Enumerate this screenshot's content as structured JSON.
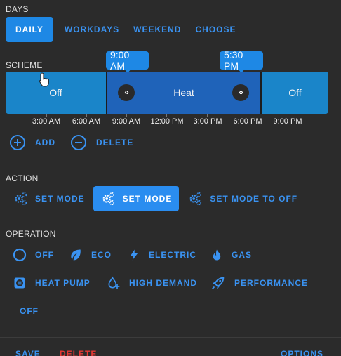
{
  "days": {
    "label": "DAYS",
    "options": [
      "DAILY",
      "WORKDAYS",
      "WEEKEND",
      "CHOOSE"
    ],
    "selected": "DAILY"
  },
  "scheme": {
    "label": "SCHEME",
    "slots": [
      {
        "label": "Off",
        "start": "0:00",
        "end": "9:00"
      },
      {
        "label": "Heat",
        "start": "9:00",
        "end": "17:30"
      },
      {
        "label": "Off",
        "start": "17:30",
        "end": "24:00"
      }
    ],
    "tooltips": [
      "9:00 AM",
      "5:30 PM"
    ],
    "handle_glyph": "‹›",
    "ticks": [
      "3:00 AM",
      "6:00 AM",
      "9:00 AM",
      "12:00 PM",
      "3:00 PM",
      "6:00 PM",
      "9:00 PM"
    ],
    "add_label": "ADD",
    "delete_label": "DELETE"
  },
  "action": {
    "label": "ACTION",
    "buttons": [
      "SET MODE",
      "SET MODE",
      "SET MODE TO OFF"
    ],
    "active_index": 1
  },
  "operation": {
    "label": "OPERATION",
    "modes": [
      {
        "label": "OFF",
        "icon": "circle-icon"
      },
      {
        "label": "ECO",
        "icon": "leaf-icon"
      },
      {
        "label": "ELECTRIC",
        "icon": "bolt-icon"
      },
      {
        "label": "GAS",
        "icon": "flame-icon"
      },
      {
        "label": "HEAT PUMP",
        "icon": "heat-pump-icon"
      },
      {
        "label": "HIGH DEMAND",
        "icon": "water-plus-icon"
      },
      {
        "label": "PERFORMANCE",
        "icon": "rocket-icon"
      },
      {
        "label": "OFF",
        "icon": ""
      }
    ]
  },
  "footer": {
    "save_label": "SAVE",
    "delete_label": "DELETE",
    "options_label": "OPTIONS"
  },
  "colors": {
    "background": "#2b2b2b",
    "accent": "#1e88e5",
    "link": "#3a93f2",
    "heat_slot": "#1f63b9",
    "off_slot": "#1a85c9",
    "danger": "#e53935"
  }
}
